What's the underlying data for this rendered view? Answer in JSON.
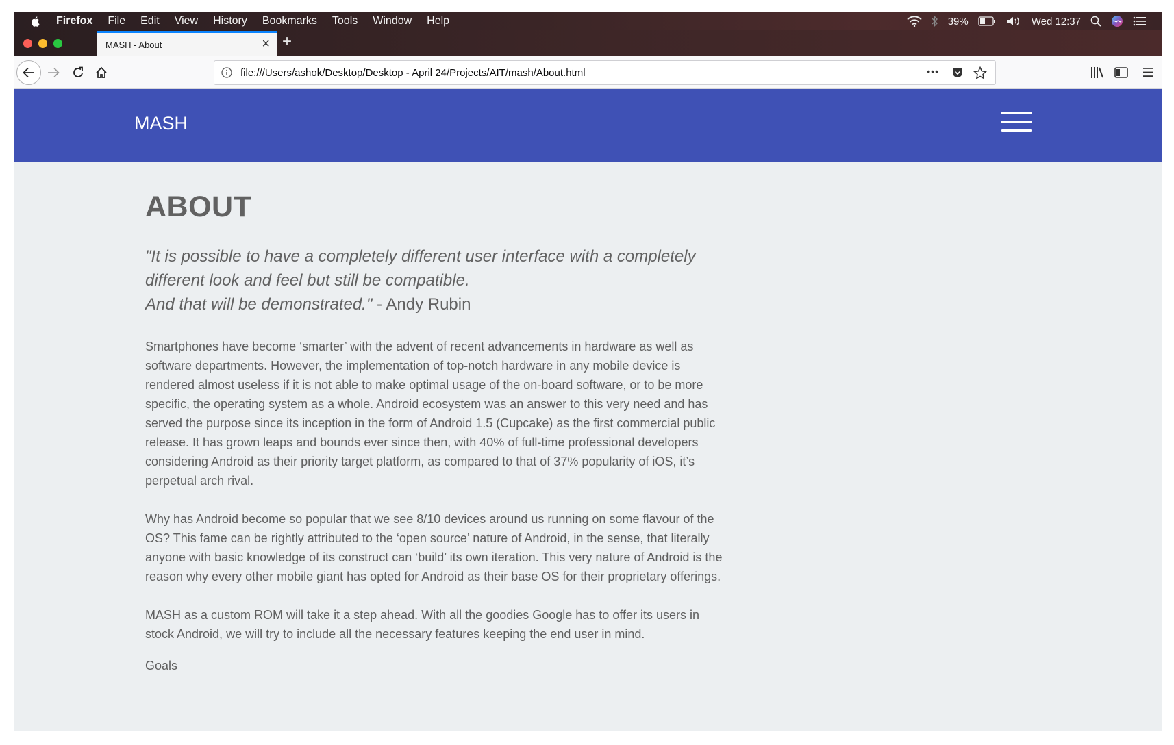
{
  "menubar": {
    "app_name": "Firefox",
    "items": [
      "File",
      "Edit",
      "View",
      "History",
      "Bookmarks",
      "Tools",
      "Window",
      "Help"
    ],
    "battery_percent": "39%",
    "clock": "Wed 12:37"
  },
  "tab": {
    "title": "MASH - About",
    "close_glyph": "×"
  },
  "newtab_glyph": "+",
  "address_bar": {
    "url": "file:///Users/ashok/Desktop/Desktop - April 24/Projects/AIT/mash/About.html",
    "more_glyph": "•••"
  },
  "site": {
    "brand": "MASH",
    "page_title": "ABOUT",
    "quote": {
      "line1": "\"It is possible to have a completely different user interface with a completely",
      "line2": "different look and feel but still be compatible.",
      "line3": "And that will be demonstrated.\"",
      "author": " - Andy Rubin"
    },
    "paragraphs": [
      "Smartphones have become ‘smarter’ with the advent of recent advancements in hardware as well as software departments. However, the implementation of top-notch hardware in any mobile device is rendered almost useless if it is not able to make optimal usage of the on-board software, or to be more specific, the operating system as a whole. Android ecosystem was an answer to this very need and has served the purpose since its inception in the form of Android 1.5 (Cupcake) as the first commercial public release. It has grown leaps and bounds ever since then, with 40% of full-time professional developers considering Android as their priority target platform, as compared to that of 37% popularity of iOS, it’s perpetual arch rival.",
      "Why has Android become so popular that we see 8/10 devices around us running on some flavour of the OS? This fame can be rightly attributed to the ‘open source’ nature of Android, in the sense, that literally anyone with basic knowledge of its construct can ‘build’ its own iteration. This very nature of Android is the reason why every other mobile giant has opted for Android as their base OS for their proprietary offerings.",
      "MASH as a custom ROM will take it a step ahead. With all the goodies Google has to offer its users in stock Android, we will try to include all the necessary features keeping the end user in mind."
    ],
    "goals_label": "Goals"
  }
}
